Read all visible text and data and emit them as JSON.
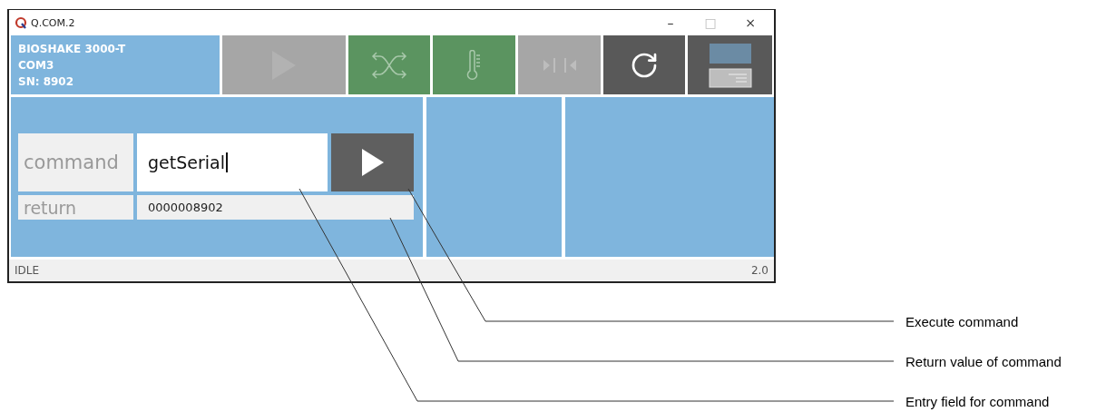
{
  "window": {
    "title": "Q.COM.2",
    "controls": [
      "–",
      "□",
      "×"
    ]
  },
  "device": {
    "lines": [
      "BIOSHAKE 3000-T",
      "COM3",
      "SN: 8902"
    ]
  },
  "toolbar": [
    {
      "kind": "play",
      "color": "#a6a6a6"
    },
    {
      "kind": "shuffle",
      "color": "#5b9460"
    },
    {
      "kind": "thermometer",
      "color": "#5b9460"
    },
    {
      "kind": "lock",
      "color": "#a6a6a6"
    },
    {
      "kind": "refresh",
      "color": "#595959"
    },
    {
      "kind": "layout",
      "color": "#595959"
    }
  ],
  "command": {
    "label": "command",
    "value": "getSerial"
  },
  "return": {
    "label": "return",
    "value": "0000008902"
  },
  "status_bar": {
    "state": "IDLE",
    "version": "2.0"
  },
  "callouts": [
    "Execute command",
    "Return value of command",
    "Entry field for command"
  ]
}
